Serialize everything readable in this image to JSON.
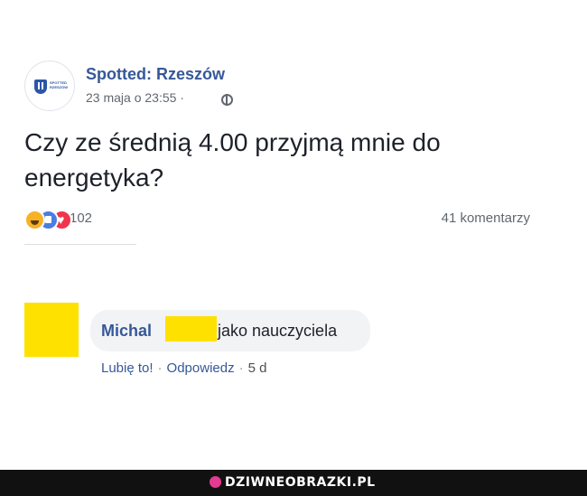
{
  "post": {
    "page_name": "Spotted: Rzeszów",
    "meta": "23 maja o 23:55 ·",
    "avatar_logo_text": "SPOTTED RZESZÓW",
    "text": "Czy ze średnią 4.00 przyjmą mnie do energetyka?",
    "reaction_count": "102",
    "comment_count": "41 komentarzy",
    "reaction_icons": [
      "haha-icon",
      "like-icon",
      "love-icon"
    ]
  },
  "comment": {
    "author": "Michal",
    "text": "jako nauczyciela",
    "like_label": "Lubię to!",
    "reply_label": "Odpowiedz",
    "time": "5 d",
    "separator": "·"
  },
  "watermark": {
    "text": "DZIWNEOBRAZKI.PL"
  },
  "colors": {
    "link": "#365899",
    "text": "#1d2129",
    "muted": "#616770",
    "redaction": "#ffe100",
    "footer": "#111111"
  }
}
